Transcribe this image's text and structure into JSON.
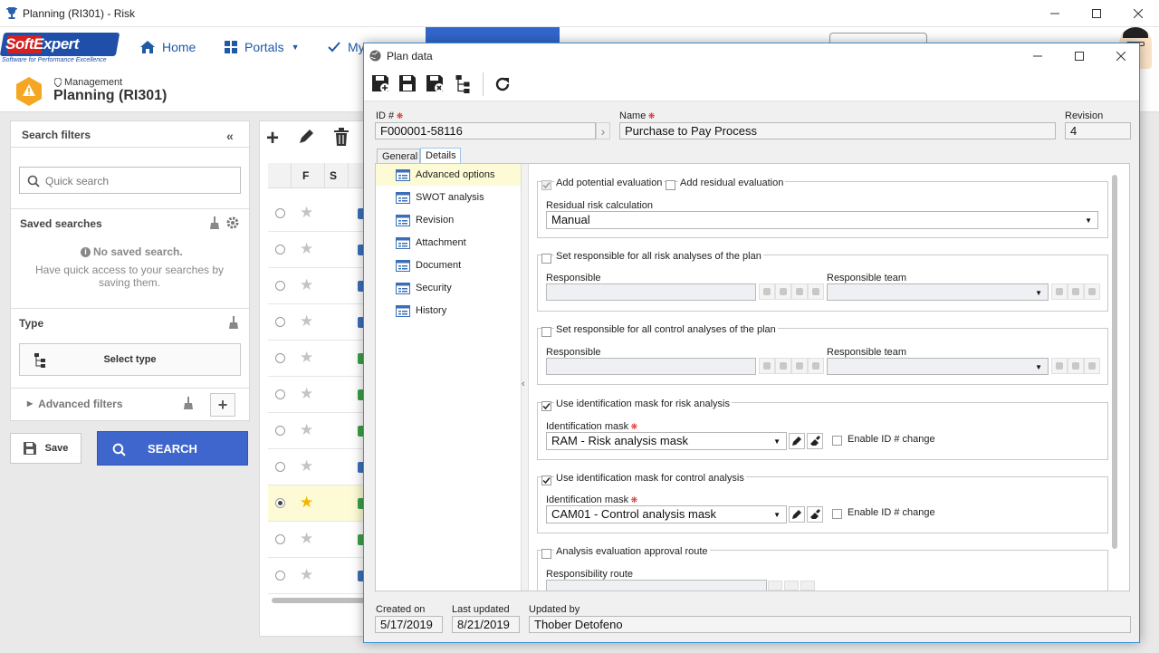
{
  "window": {
    "title": "Planning (RI301) - Risk"
  },
  "nav": {
    "home": "Home",
    "portals": "Portals",
    "my": "My"
  },
  "logo": {
    "brand": "SoftExpert",
    "tagline": "Software for Performance Excellence"
  },
  "header": {
    "breadcrumb": "Management",
    "title": "Planning (RI301)"
  },
  "filters": {
    "title": "Search filters",
    "quick_search_placeholder": "Quick search",
    "saved_searches": "Saved searches",
    "no_saved": "No saved search.",
    "no_saved_hint": "Have quick access to your searches by saving them.",
    "type": "Type",
    "select_type": "Select type",
    "advanced": "Advanced filters",
    "save": "Save",
    "search": "SEARCH"
  },
  "grid": {
    "col_f": "F",
    "col_s": "S"
  },
  "dialog": {
    "title": "Plan data",
    "id_label": "ID #",
    "id_value": "F000001-58116",
    "name_label": "Name",
    "name_value": "Purchase to Pay Process",
    "revision_label": "Revision",
    "revision_value": "4",
    "tabs": [
      "General",
      "Details"
    ],
    "tree": [
      "Advanced options",
      "SWOT analysis",
      "Revision",
      "Attachment",
      "Document",
      "Security",
      "History"
    ],
    "add_potential": "Add potential evaluation",
    "add_residual": "Add residual evaluation",
    "residual_calc_label": "Residual risk calculation",
    "residual_calc_value": "Manual",
    "set_resp_risk": "Set responsible for all risk analyses of the plan",
    "set_resp_control": "Set responsible for all control analyses of the plan",
    "responsible": "Responsible",
    "responsible_team": "Responsible team",
    "use_mask_risk": "Use identification mask for risk analysis",
    "use_mask_control": "Use identification mask for control analysis",
    "id_mask_label": "Identification mask",
    "mask_risk_value": "RAM - Risk analysis mask",
    "mask_control_value": "CAM01 - Control analysis mask",
    "enable_id_change": "Enable ID # change",
    "approval_route": "Analysis evaluation approval route",
    "responsibility_route": "Responsibility route",
    "created_on_label": "Created on",
    "created_on": "5/17/2019",
    "last_updated_label": "Last updated",
    "last_updated": "8/21/2019",
    "updated_by_label": "Updated by",
    "updated_by": "Thober Detofeno"
  }
}
